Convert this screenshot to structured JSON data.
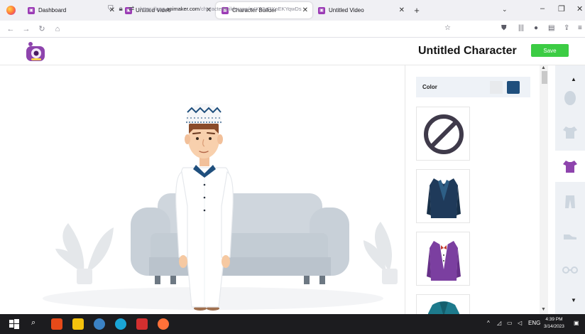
{
  "browser": {
    "tabs": [
      {
        "label": "Dashboard",
        "active": false
      },
      {
        "label": "Untitled Video",
        "active": false
      },
      {
        "label": "Character Builder",
        "active": true
      },
      {
        "label": "Untitled Video",
        "active": false
      }
    ],
    "url_prefix": "https://app.",
    "url_domain": "animaker.com",
    "url_path": "/characterbuilderapp/mIX23zRXoEKYqwDs"
  },
  "header": {
    "title": "Untitled Character",
    "save_label": "Save"
  },
  "panel": {
    "color_label": "Color",
    "swatches": [
      "#e8eaed",
      "#1f4f7d"
    ]
  },
  "taskbar": {
    "language": "ENG",
    "time": "4:39 PM",
    "date": "3/14/2023"
  },
  "colors": {
    "accent_green": "#3ccc44",
    "selected_option_blue": "#1f4f7d",
    "rail_bg": "#eef1f5"
  }
}
